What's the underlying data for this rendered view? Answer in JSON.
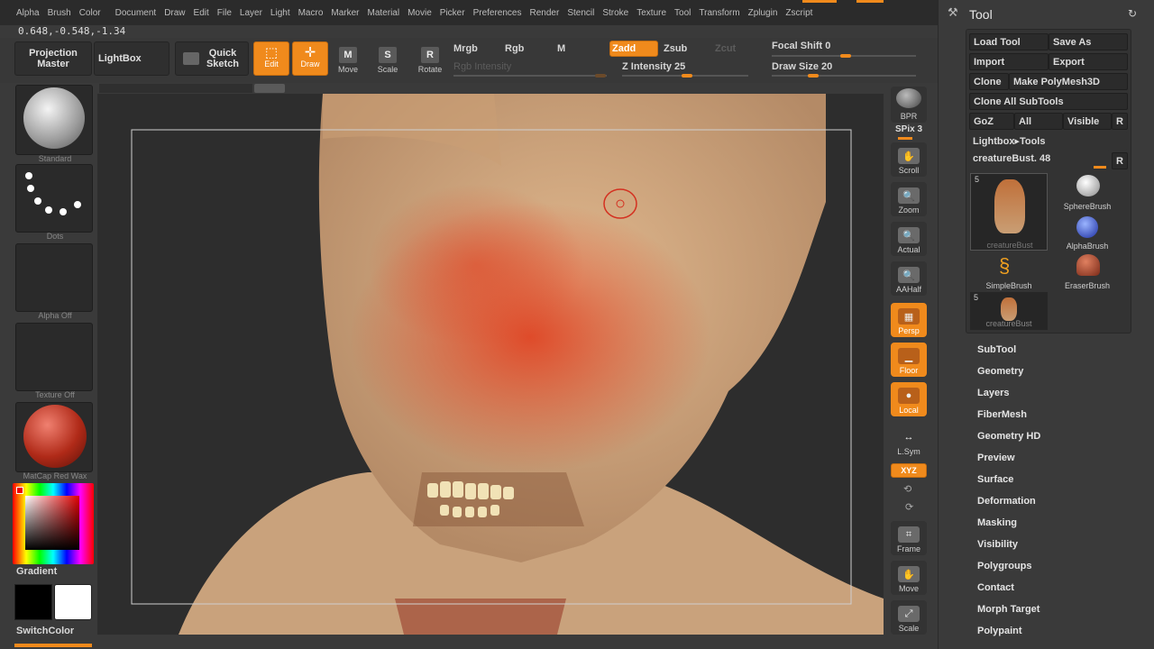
{
  "menu": [
    "Alpha",
    "Brush",
    "Color",
    "Document",
    "Draw",
    "Edit",
    "File",
    "Layer",
    "Light",
    "Macro",
    "Marker",
    "Material",
    "Movie",
    "Picker",
    "Preferences",
    "Render",
    "Stencil",
    "Stroke",
    "Texture",
    "Tool",
    "Transform",
    "Zplugin",
    "Zscript"
  ],
  "coords": "0.648,-0.548,-1.34",
  "toolbar": {
    "projection_master": "Projection Master",
    "lightbox": "LightBox",
    "quick_sketch": "Quick Sketch",
    "edit": "Edit",
    "draw": "Draw",
    "move": "Move",
    "scale": "Scale",
    "rotate": "Rotate",
    "mrgb": "Mrgb",
    "rgb": "Rgb",
    "m": "M",
    "zadd": "Zadd",
    "zsub": "Zsub",
    "zcut": "Zcut",
    "rgb_intensity": "Rgb Intensity",
    "z_intensity": "Z Intensity 25",
    "focal_shift": "Focal Shift 0",
    "draw_size": "Draw Size 20",
    "z_intensity_value": 25,
    "focal_shift_value": 0,
    "draw_size_value": 20
  },
  "left": {
    "standard": "Standard",
    "dots": "Dots",
    "alpha": "Alpha Off",
    "texture": "Texture Off",
    "material": "MatCap Red Wax",
    "gradient": "Gradient",
    "switch_color": "SwitchColor"
  },
  "right": {
    "bpr": "BPR",
    "spix": "SPix 3",
    "scroll": "Scroll",
    "zoom": "Zoom",
    "actual": "Actual",
    "aahalf": "AAHalf",
    "persp": "Persp",
    "floor": "Floor",
    "local": "Local",
    "lsym": "L.Sym",
    "xyz": "XYZ",
    "frame": "Frame",
    "move": "Move",
    "scale": "Scale"
  },
  "tool": {
    "title": "Tool",
    "load_tool": "Load Tool",
    "save_as": "Save As",
    "import": "Import",
    "export": "Export",
    "clone": "Clone",
    "make_polymesh": "Make PolyMesh3D",
    "clone_all": "Clone All SubTools",
    "goz": "GoZ",
    "all": "All",
    "visible": "Visible",
    "r": "R",
    "lightbox_tools": "Lightbox▸Tools",
    "current_tool": "creatureBust. 48",
    "thumbs": [
      {
        "label": "creatureBust",
        "badge": "5"
      },
      {
        "label": "SphereBrush"
      },
      {
        "label": "AlphaBrush"
      },
      {
        "label": "SimpleBrush"
      },
      {
        "label": "EraserBrush"
      },
      {
        "label": "creatureBust",
        "badge": "5"
      }
    ],
    "sections": [
      "SubTool",
      "Geometry",
      "Layers",
      "FiberMesh",
      "Geometry HD",
      "Preview",
      "Surface",
      "Deformation",
      "Masking",
      "Visibility",
      "Polygroups",
      "Contact",
      "Morph Target",
      "Polypaint"
    ]
  },
  "colors": {
    "accent": "#f08a1c",
    "panel": "#3a3a3a",
    "dark": "#2b2b2b"
  }
}
